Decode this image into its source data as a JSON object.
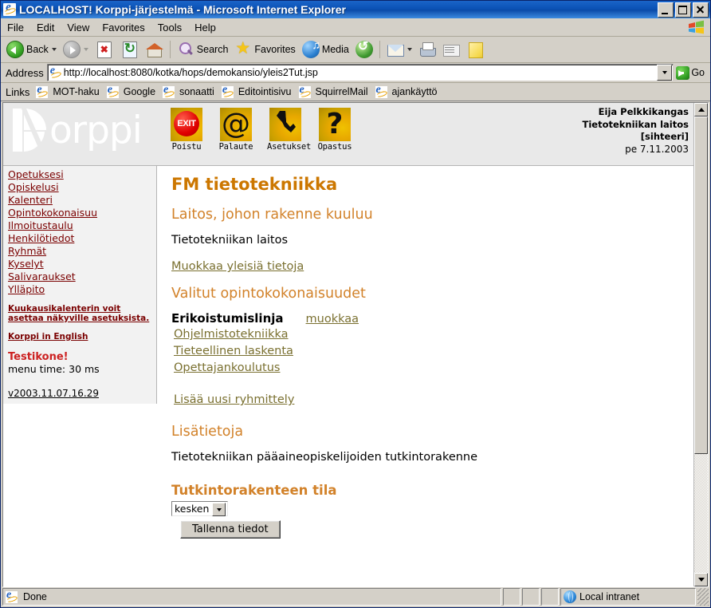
{
  "window": {
    "title": "LOCALHOST! Korppi-järjestelmä - Microsoft Internet Explorer",
    "minimize": "_",
    "maximize": "□",
    "close": "×"
  },
  "menubar": {
    "items": [
      "File",
      "Edit",
      "View",
      "Favorites",
      "Tools",
      "Help"
    ]
  },
  "toolbar": {
    "back": "Back",
    "search": "Search",
    "favorites": "Favorites",
    "media": "Media"
  },
  "address": {
    "label": "Address",
    "url": "http://localhost:8080/kotka/hops/demokansio/yleis2Tut.jsp",
    "go": "Go"
  },
  "links": {
    "label": "Links",
    "items": [
      "MOT-haku",
      "Google",
      "sonaatti",
      "Editointisivu",
      "SquirrelMail",
      "ajankäyttö"
    ]
  },
  "korppi": {
    "logo_word": "orppi",
    "icons": [
      {
        "label": "Poistu",
        "glyph": "EXIT",
        "kind": "exit"
      },
      {
        "label": "Palaute",
        "glyph": "@",
        "kind": "at"
      },
      {
        "label": "Asetukset",
        "glyph": "🔧",
        "kind": "wrench"
      },
      {
        "label": "Opastus",
        "glyph": "?",
        "kind": "question"
      }
    ],
    "user": {
      "name": "Eija Pelkkikangas",
      "unit": "Tietotekniikan laitos",
      "role": "[sihteeri]",
      "date": "pe 7.11.2003"
    }
  },
  "sidebar": {
    "items": [
      "Opetuksesi",
      "Opiskelusi",
      "Kalenteri",
      "Opintokokonaisuu",
      "Ilmoitustaulu",
      "Henkilötiedot",
      "Ryhmät",
      "Kyselyt",
      "Salivaraukset",
      "Ylläpito"
    ],
    "note": "Kuukausikalenterin voit asettaa näkyville asetuksista.",
    "english_link": "Korppi in English",
    "testikone": "Testikone!",
    "menu_time": "menu time: 30 ms",
    "version": "v2003.11.07.16.29"
  },
  "content": {
    "title": "FM tietotekniikka",
    "section_unit_heading": "Laitos, johon rakenne kuuluu",
    "unit_name": "Tietotekniikan laitos",
    "edit_general_link": "Muokkaa yleisiä tietoja",
    "section_modules_heading": "Valitut opintokokonaisuudet",
    "line_title": "Erikoistumislinja",
    "line_edit_link": "muokkaa",
    "line_options": [
      "Ohjelmistotekniikka",
      "Tieteellinen laskenta",
      "Opettajankoulutus"
    ],
    "add_group_link": "Lisää uusi ryhmittely",
    "section_extra_heading": "Lisätietoja",
    "extra_text": "Tietotekniikan pääaineopiskelijoiden tutkintorakenne",
    "status_heading": "Tutkintorakenteen tila",
    "status_value": "kesken",
    "save_button": "Tallenna tiedot"
  },
  "statusbar": {
    "status": "Done",
    "zone": "Local intranet"
  }
}
